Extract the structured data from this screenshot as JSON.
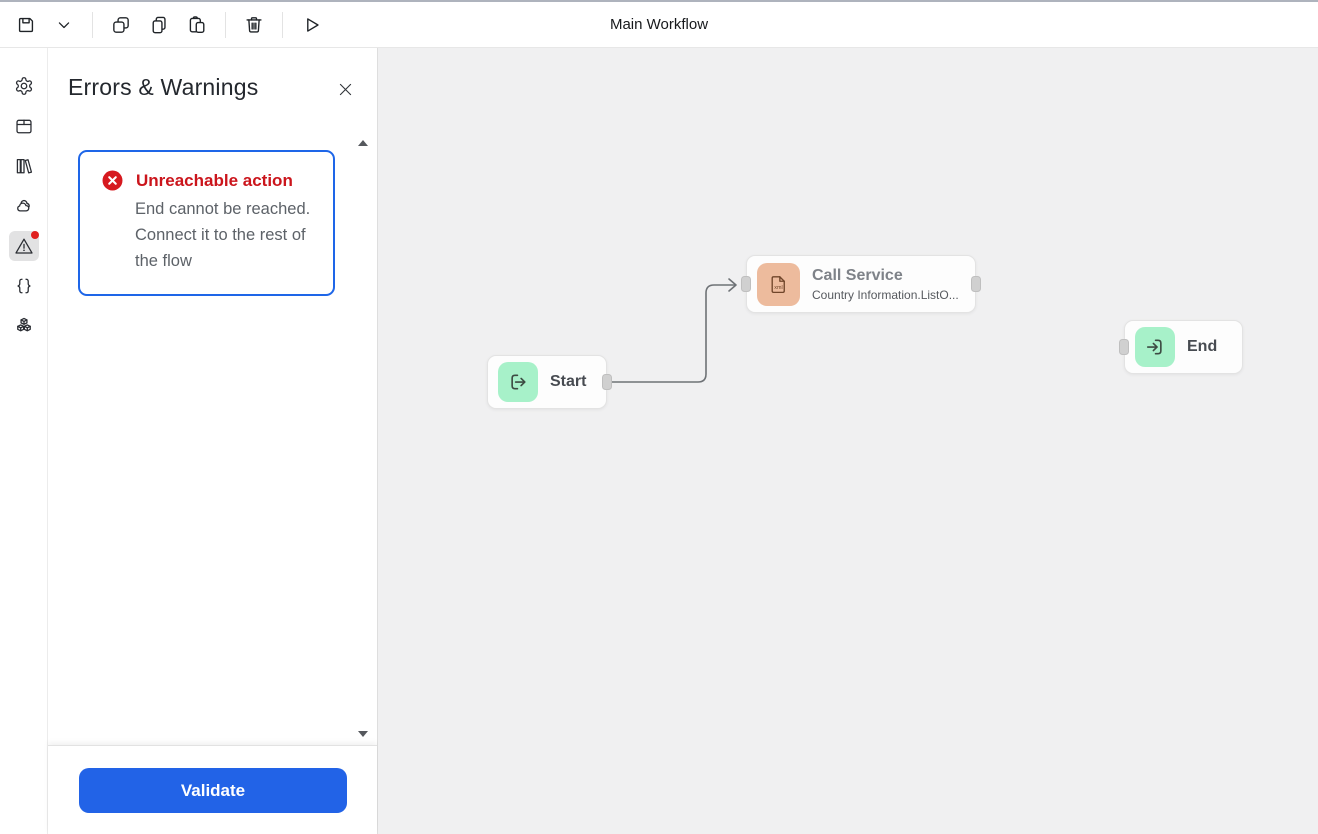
{
  "window": {
    "title": "Main Workflow"
  },
  "toolbar": {
    "items": [
      "save",
      "save-options-dropdown",
      "duplicate",
      "copy",
      "paste",
      "delete",
      "run"
    ]
  },
  "sidebar": {
    "items": [
      "settings",
      "packages",
      "library",
      "cloud",
      "errors-warnings",
      "code",
      "modules"
    ],
    "active": "errors-warnings",
    "badge_color": "#e0201f"
  },
  "errors_panel": {
    "title": "Errors & Warnings",
    "errors": [
      {
        "severity": "error",
        "title": "Unreachable action",
        "message": "End cannot be reached. Connect it to the rest of the flow"
      }
    ],
    "validate_label": "Validate"
  },
  "canvas": {
    "nodes": [
      {
        "id": "start",
        "label": "Start",
        "icon": "start-arrow-icon",
        "icon_color": "#a7f1c9"
      },
      {
        "id": "call-service",
        "label": "Call Service",
        "subtitle": "Country Information.ListO...",
        "badge": "xml",
        "icon": "xml-document-icon",
        "icon_color": "#edbb9d"
      },
      {
        "id": "end",
        "label": "End",
        "icon": "end-arrow-icon",
        "icon_color": "#a7f1c9"
      }
    ],
    "edges": [
      {
        "from": "start",
        "to": "call-service"
      }
    ]
  },
  "colors": {
    "accent_blue": "#2263e7",
    "error_red": "#cb151c",
    "canvas_bg": "#f0f0f1",
    "node_green": "#a7f1c9",
    "node_tan": "#edbb9d"
  }
}
